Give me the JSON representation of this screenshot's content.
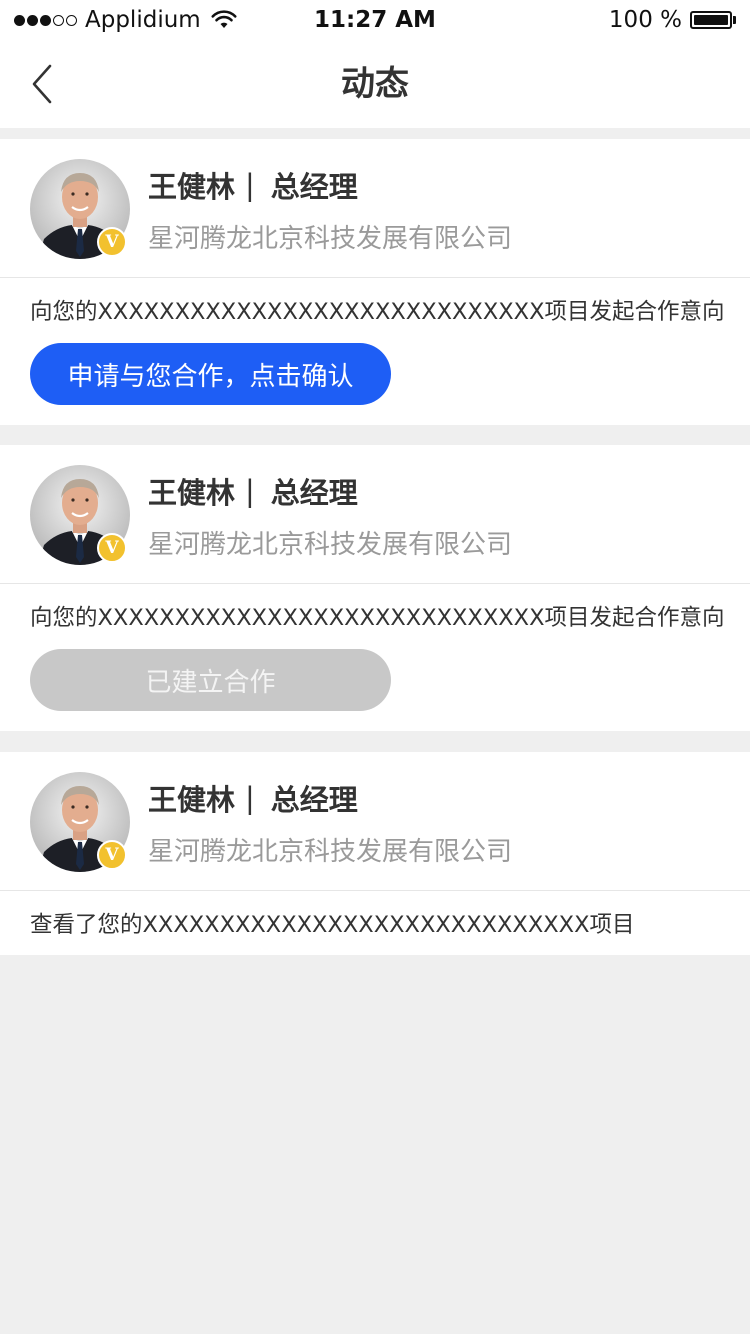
{
  "status_bar": {
    "carrier": "Applidium",
    "time": "11:27 AM",
    "battery_percent": "100 %",
    "signal_bars_filled": 3,
    "signal_bars_total": 5,
    "battery_level": 1.0
  },
  "nav": {
    "title": "动态",
    "back_icon": "chevron-left-icon"
  },
  "feed": [
    {
      "name": "王健林",
      "separator": "|",
      "position": "总经理",
      "company": "星河腾龙北京科技发展有限公司",
      "badge": "V",
      "activity": "向您的XXXXXXXXXXXXXXXXXXXXXXXXXXXXX项目发起合作意向",
      "action_label": "申请与您合作，点击确认",
      "action_state": "primary"
    },
    {
      "name": "王健林",
      "separator": "|",
      "position": "总经理",
      "company": "星河腾龙北京科技发展有限公司",
      "badge": "V",
      "activity": "向您的XXXXXXXXXXXXXXXXXXXXXXXXXXXXX项目发起合作意向",
      "action_label": "已建立合作",
      "action_state": "disabled"
    },
    {
      "name": "王健林",
      "separator": "|",
      "position": "总经理",
      "company": "星河腾龙北京科技发展有限公司",
      "badge": "V",
      "activity": "查看了您的XXXXXXXXXXXXXXXXXXXXXXXXXXXXX项目"
    }
  ],
  "colors": {
    "accent": "#1e5ef5",
    "disabled_button": "#c8c8c8",
    "badge": "#f2c12e",
    "page_background": "#efefef",
    "secondary_text": "#9a9a9a"
  }
}
